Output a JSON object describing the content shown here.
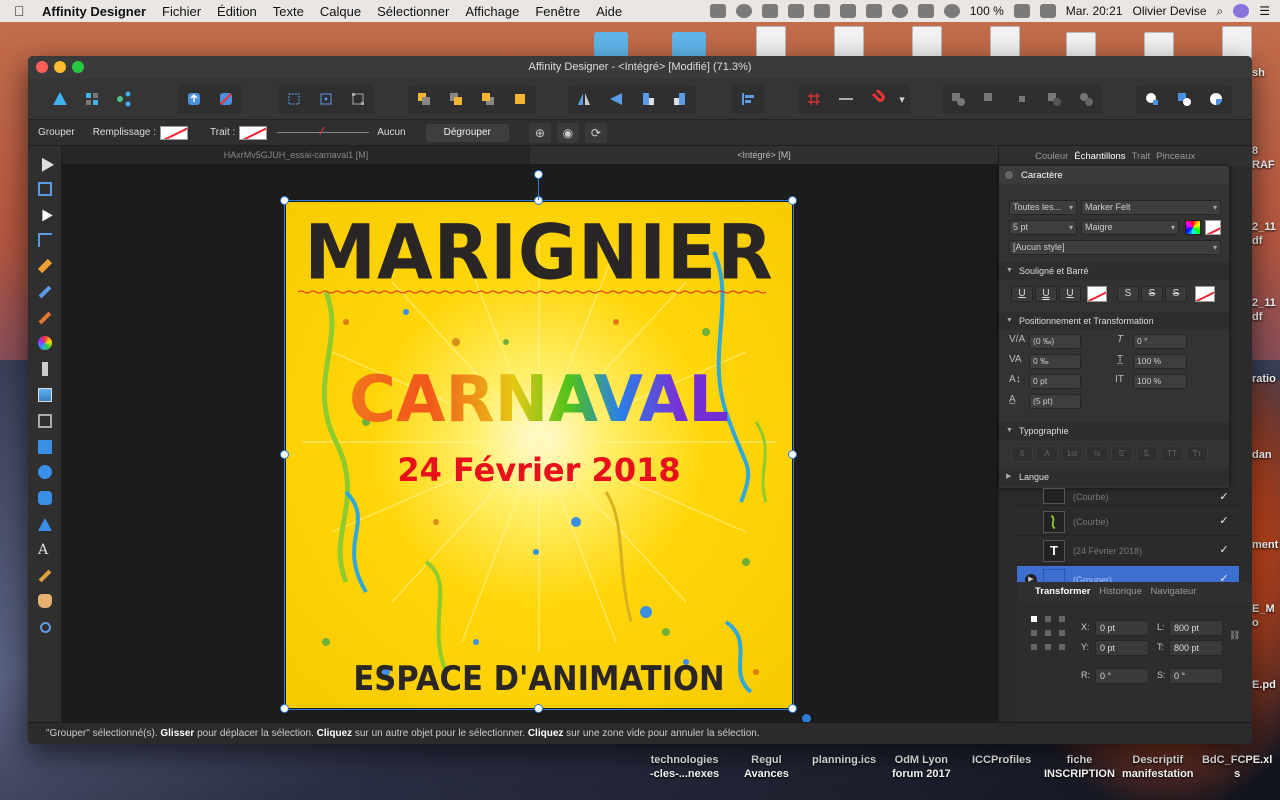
{
  "menubar": {
    "app_name": "Affinity Designer",
    "items": [
      "Fichier",
      "Édition",
      "Texte",
      "Calque",
      "Sélectionner",
      "Affichage",
      "Fenêtre",
      "Aide"
    ],
    "battery": "100 %",
    "clock": "Mar. 20:21",
    "user": "Olivier Devise"
  },
  "window": {
    "title": "Affinity Designer - <Intégré> [Modifié] (71.3%)"
  },
  "context_toolbar": {
    "group_label": "Grouper",
    "fill_label": "Remplissage :",
    "stroke_label": "Trait :",
    "stroke_value": "Aucun",
    "ungroup_button": "Dégrouper"
  },
  "doc_tabs": [
    "HAxrMv5GJUH_essai-carnaval1 [M]",
    "<Intégré> [M]"
  ],
  "artboard": {
    "title": "MARIGNIER",
    "event": "CARNAVAL",
    "date": "24 Février 2018",
    "place": "ESPACE D'ANIMATION"
  },
  "status_bar": {
    "part1": "\"Grouper\" sélectionné(s). ",
    "b1": "Glisser",
    "part2": " pour déplacer la sélection. ",
    "b2": "Cliquez",
    "part3": " sur un autre objet pour le sélectionner. ",
    "b3": "Cliquez",
    "part4": " sur une zone vide pour annuler la sélection."
  },
  "right_panel": {
    "tabs": [
      "Couleur",
      "Échantillons",
      "Trait",
      "Pinceaux"
    ],
    "character": {
      "title": "Caractère",
      "collection": "Toutes les...",
      "font": "Marker Felt",
      "size": "5 pt",
      "weight": "Maigre",
      "style": "[Aucun style]",
      "underline_section": "Souligné et Barré",
      "position_section": "Positionnement et Transformation",
      "kerning": "(0 ‰)",
      "tracking": "0 ‰",
      "baseline": "0 pt",
      "leading": "(5 pt)",
      "skew": "0 °",
      "hscale": "100 %",
      "vscale": "100 %",
      "typography_section": "Typographie",
      "language_section": "Langue"
    },
    "layers": [
      {
        "name": "(Courbe)"
      },
      {
        "name": "(Courbe)"
      },
      {
        "name": "(24 Février 2018)"
      },
      {
        "name": "(Grouper)"
      }
    ],
    "transform": {
      "tabs": [
        "Transformer",
        "Historique",
        "Navigateur"
      ],
      "x_label": "X:",
      "x": "0 pt",
      "y_label": "Y:",
      "y": "0 pt",
      "w_label": "L:",
      "w": "800 pt",
      "h_label": "T:",
      "h": "800 pt",
      "r_label": "R:",
      "r": "0 °",
      "s_label": "S:",
      "s": "0 °"
    }
  },
  "desktop": {
    "labels": [
      "technologies\n-cles-...nexes",
      "Regul\nAvances",
      "planning.ics",
      "OdM Lyon\nforum 2017",
      "ICCProfiles",
      "fiche\nINSCRIPTION",
      "Descriptif\nmanifestation",
      "BdC_FCPE.xl\ns"
    ],
    "side_labels": [
      "sh",
      "8\nRAF",
      "2_11\ndf",
      "2_11\ndf",
      "ratio",
      "dan",
      "ment",
      "E_M\no",
      "E.pd"
    ]
  }
}
